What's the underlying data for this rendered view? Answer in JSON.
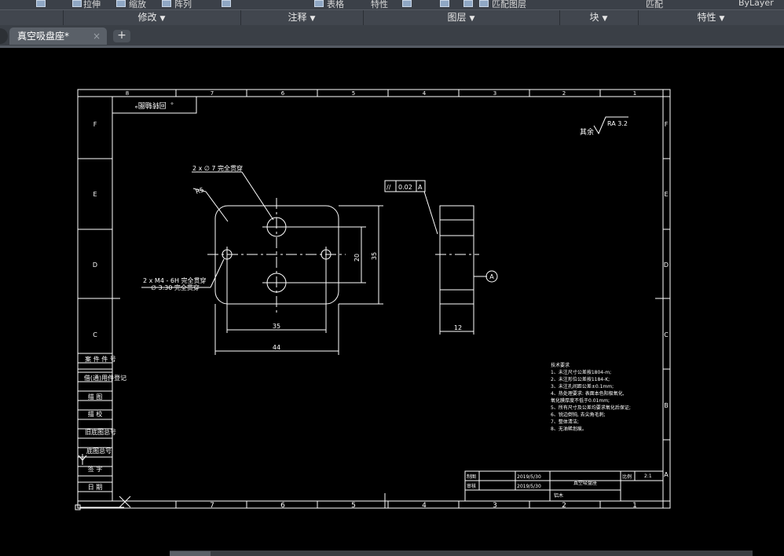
{
  "ribbon": {
    "panels": [
      {
        "id": "modify",
        "label": "修改"
      },
      {
        "id": "annotate",
        "label": "注释"
      },
      {
        "id": "layers",
        "label": "图层"
      },
      {
        "id": "block",
        "label": "块"
      },
      {
        "id": "properties",
        "label": "特性"
      }
    ],
    "top_row": {
      "modify_items": [
        "拉伸",
        "缩放",
        "阵列"
      ],
      "table_label": "表格",
      "layer_props_label": "特性",
      "layer_match_label": "匹配图层",
      "match_label": "匹配",
      "bylayer": "ByLayer"
    }
  },
  "tabs": {
    "active": {
      "title": "真空吸盘座*",
      "close": "×"
    },
    "add": "+"
  },
  "drawing": {
    "col_numbers": [
      "8",
      "7",
      "6",
      "5",
      "4",
      "3",
      "2",
      "1"
    ],
    "row_letters": [
      "F",
      "E",
      "D",
      "C",
      "B",
      "A"
    ],
    "flipped_box_text": "。回转轴图°",
    "surface_finish": {
      "prefix": "其余",
      "value": "RA 3.2"
    },
    "front_view": {
      "callout_holes": "2 x ∅ 7 完全贯穿",
      "radius": "R5",
      "callout_tapped_1": "2 x  M4 - 6H 完全贯穿",
      "callout_tapped_2": "∅ 3.30 完全贯穿",
      "dim_20": "20",
      "dim_35_vertical": "35",
      "dim_35_horizontal": "35",
      "dim_44": "44"
    },
    "side_view": {
      "tolerance_symbol": "//",
      "tolerance_value": "0.02",
      "datum": "A",
      "datum_flag": "A",
      "dim_12": "12"
    },
    "tech_notes": {
      "title": "技术要求",
      "lines": [
        "1、未注尺寸公差按1804-m;",
        "2、未注形位公差按1184-K;",
        "3、未注孔间距公差±0.1mm;",
        "4、热处理要求: 表面本色阳极氧化,",
        "氧化膜厚度不低于0.01mm;",
        "5、所有尺寸及公差均要求氧化后保证;",
        "6、锐边倒钝, 去尖角毛刺;",
        "7、整体清洁;",
        "8、无油稀划痕。"
      ]
    },
    "left_strip": [
      "案 件 件 号",
      "借(通)用件登记",
      "描 图",
      "描 校",
      "旧底图总号",
      "底图总号",
      "签 字",
      "日 期"
    ],
    "title_block": {
      "row1_label": "制图",
      "row2_label": "审核",
      "date1": "2019/5/30",
      "date2": "2019/5/30",
      "part_name": "真空吸盘座",
      "material": "铝木",
      "scale_label": "比例",
      "scale_value": "2:1"
    }
  },
  "colors": {
    "ribbon_bg": "#41464e",
    "tab_active": "#5a6068",
    "canvas_bg": "#000000",
    "lines": "#ffffff"
  }
}
